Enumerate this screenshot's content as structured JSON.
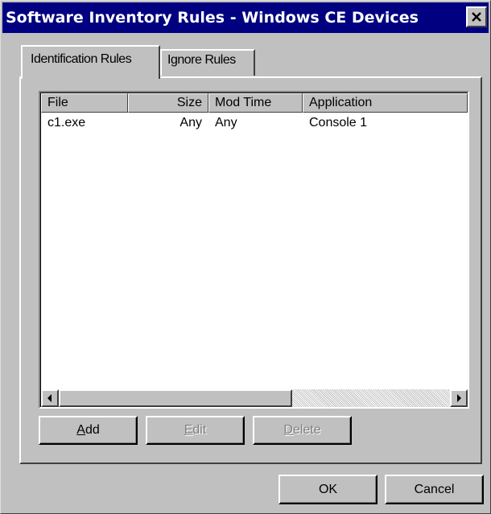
{
  "window": {
    "title": "Software Inventory Rules - Windows CE Devices",
    "close_label": "×"
  },
  "tabs": [
    {
      "label": "Identification Rules",
      "active": true
    },
    {
      "label": "Ignore Rules",
      "active": false
    }
  ],
  "table": {
    "columns": [
      "File",
      "Size",
      "Mod Time",
      "Application"
    ],
    "rows": [
      {
        "file": "c1.exe",
        "size": "Any",
        "mod_time": "Any",
        "application": "Console 1"
      }
    ]
  },
  "scrollbar": {
    "left_icon": "scroll-left-arrow-icon",
    "right_icon": "scroll-right-arrow-icon"
  },
  "buttons": {
    "add": {
      "mnemonic": "A",
      "rest": "dd"
    },
    "edit": {
      "mnemonic": "E",
      "rest": "dit"
    },
    "delete": {
      "mnemonic": "D",
      "rest": "elete"
    },
    "ok": "OK",
    "cancel": "Cancel"
  }
}
